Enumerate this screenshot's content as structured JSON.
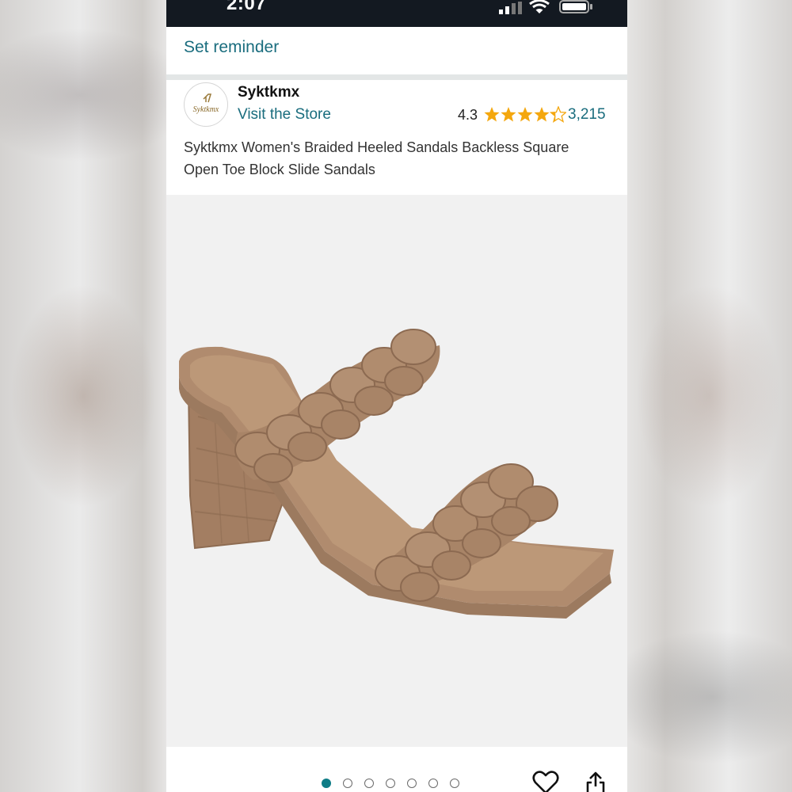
{
  "status_bar": {
    "time": "2:07",
    "icons": [
      "signal-icon",
      "wifi-icon",
      "battery-icon"
    ]
  },
  "reminder": {
    "label": "Set reminder"
  },
  "store": {
    "logo_text": "Syktkmx",
    "brand": "Syktkmx",
    "visit_label": "Visit the Store"
  },
  "rating": {
    "value": "4.3",
    "stars": 4.3,
    "max_stars": 5,
    "review_count": "3,215"
  },
  "product": {
    "title": "Syktkmx Women's Braided Heeled Sandals Backless Square Open Toe Block Slide Sandals"
  },
  "gallery": {
    "image_count": 7,
    "active_index": 0,
    "actions": [
      "heart-icon",
      "share-icon"
    ]
  },
  "colors": {
    "status_bar_bg": "#131921",
    "link": "#1a6d7e",
    "star": "#f4a70e",
    "active_dot": "#0e7c86",
    "sandal": "#a98468"
  }
}
